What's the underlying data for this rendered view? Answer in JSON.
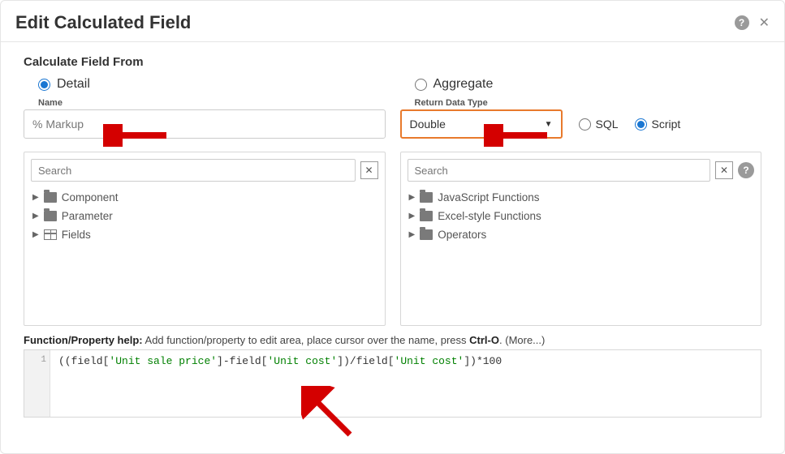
{
  "dialog": {
    "title": "Edit Calculated Field",
    "section_label": "Calculate Field From",
    "detail_label": "Detail",
    "aggregate_label": "Aggregate",
    "name_label": "Name",
    "name_value": "% Markup",
    "return_type_label": "Return Data Type",
    "return_type_value": "Double",
    "sql_label": "SQL",
    "script_label": "Script"
  },
  "left_tree": {
    "search_placeholder": "Search",
    "items": [
      "Component",
      "Parameter",
      "Fields"
    ]
  },
  "right_tree": {
    "search_placeholder": "Search",
    "items": [
      "JavaScript Functions",
      "Excel-style Functions",
      "Operators"
    ]
  },
  "help_line": {
    "prefix": "Function/Property help:",
    "text": "Add function/property to edit area, place cursor over the name, press",
    "key": "Ctrl-O",
    "more": "(More...)"
  },
  "editor": {
    "line_num": "1",
    "code_prefix_a": "((field[",
    "str_1": "'Unit sale price'",
    "code_mid_a": "]-field[",
    "str_2": "'Unit cost'",
    "code_mid_b": "])/field[",
    "str_3": "'Unit cost'",
    "code_suffix": "])*100"
  }
}
